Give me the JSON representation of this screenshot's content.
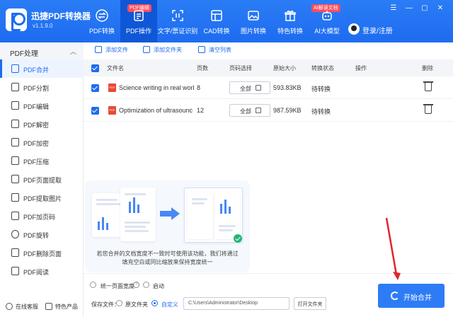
{
  "app": {
    "name": "迅捷PDF转换器",
    "version": "v1.1.9.0"
  },
  "nav": [
    {
      "label": "PDF转换",
      "icon": "swap-icon"
    },
    {
      "label": "PDF操作",
      "icon": "pdf-ops-icon",
      "active": true,
      "tag": "PDF编辑"
    },
    {
      "label": "文字/票证识别",
      "icon": "ocr-icon"
    },
    {
      "label": "CAD转换",
      "icon": "cad-icon"
    },
    {
      "label": "图片转换",
      "icon": "image-icon"
    },
    {
      "label": "特色转换",
      "icon": "gift-icon"
    },
    {
      "label": "AI大模型",
      "icon": "robot-icon",
      "tag": "AI解读文档"
    }
  ],
  "user": {
    "login_label": "登录/注册"
  },
  "sidebar": {
    "header": "PDF处理",
    "items": [
      {
        "label": "PDF合并",
        "active": true
      },
      {
        "label": "PDF分割"
      },
      {
        "label": "PDF编辑"
      },
      {
        "label": "PDF解密"
      },
      {
        "label": "PDF加密"
      },
      {
        "label": "PDF压缩"
      },
      {
        "label": "PDF页面提取"
      },
      {
        "label": "PDF提取图片"
      },
      {
        "label": "PDF加页码"
      },
      {
        "label": "PDF旋转"
      },
      {
        "label": "PDF删除页面"
      },
      {
        "label": "PDF阅读"
      }
    ],
    "footer": {
      "support": "在线客服",
      "featured": "特色产品"
    }
  },
  "toolbar": {
    "add_file": "添加文件",
    "add_folder": "添加文件夹",
    "clear_list": "清空列表"
  },
  "table": {
    "headers": {
      "name": "文件名",
      "pages": "页数",
      "page_select": "页码选择",
      "size": "原始大小",
      "status": "转换状态",
      "action": "操作",
      "delete": "删除"
    },
    "rows": [
      {
        "name": "Science writing in real worl",
        "pages": "8",
        "range": "全部",
        "size": "593.83KB",
        "status": "待转换"
      },
      {
        "name": "Optimization of ultrasounc",
        "pages": "12",
        "range": "全部",
        "size": "987.59KB",
        "status": "待转换"
      }
    ]
  },
  "tip": {
    "line1": "若您合并的文档宽度不一致时可使用该功能，我们将通过",
    "line2": "填充空白或同比缩放来保持宽度统一"
  },
  "bottom": {
    "unify_width": "统一页面宽度",
    "enable": "启动",
    "save_label": "保存文件：",
    "original_folder": "原文件夹",
    "custom": "自定义",
    "path": "C:\\Users\\Administrator\\Desktop",
    "open_folder": "打开文件夹",
    "start": "开始合并"
  },
  "colors": {
    "brand": "#1d6cf0",
    "tag": "#ff4d5e",
    "pdf": "#e94a35",
    "success": "#22b573",
    "annotation": "#e0262b"
  }
}
